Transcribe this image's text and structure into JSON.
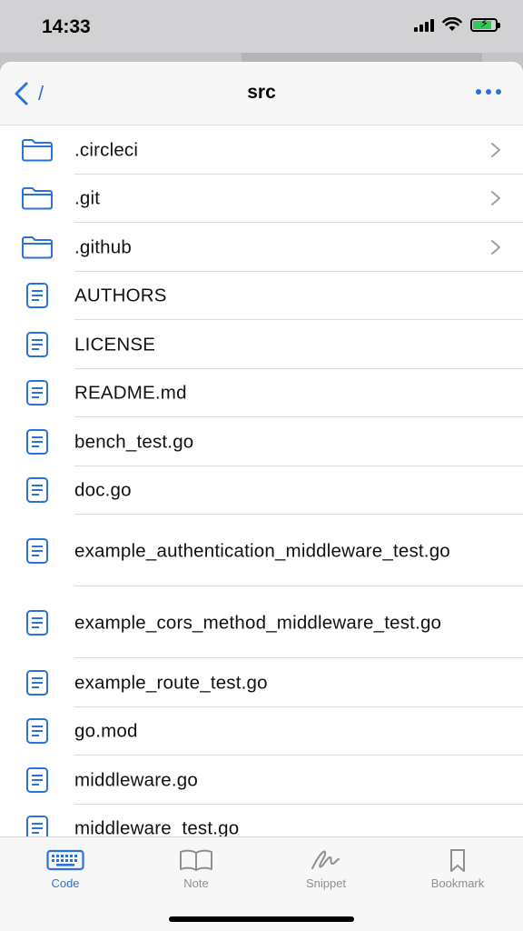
{
  "status_bar": {
    "time": "14:33"
  },
  "nav": {
    "path": "/",
    "title": "src"
  },
  "files": [
    {
      "name": ".circleci",
      "type": "folder"
    },
    {
      "name": ".git",
      "type": "folder"
    },
    {
      "name": ".github",
      "type": "folder"
    },
    {
      "name": "AUTHORS",
      "type": "file"
    },
    {
      "name": "LICENSE",
      "type": "file"
    },
    {
      "name": "README.md",
      "type": "file"
    },
    {
      "name": "bench_test.go",
      "type": "file"
    },
    {
      "name": "doc.go",
      "type": "file"
    },
    {
      "name": "example_authentication_middleware_test.go",
      "type": "file"
    },
    {
      "name": "example_cors_method_middleware_test.go",
      "type": "file"
    },
    {
      "name": "example_route_test.go",
      "type": "file"
    },
    {
      "name": "go.mod",
      "type": "file"
    },
    {
      "name": "middleware.go",
      "type": "file"
    },
    {
      "name": "middleware_test.go",
      "type": "file"
    }
  ],
  "tabs": [
    {
      "label": "Code",
      "icon": "keyboard-icon",
      "active": true
    },
    {
      "label": "Note",
      "icon": "book-icon",
      "active": false
    },
    {
      "label": "Snippet",
      "icon": "scribble-icon",
      "active": false
    },
    {
      "label": "Bookmark",
      "icon": "bookmark-icon",
      "active": false
    }
  ],
  "colors": {
    "accent": "#2b72d8",
    "inactive": "#8e8e93",
    "battery": "#34c759"
  }
}
